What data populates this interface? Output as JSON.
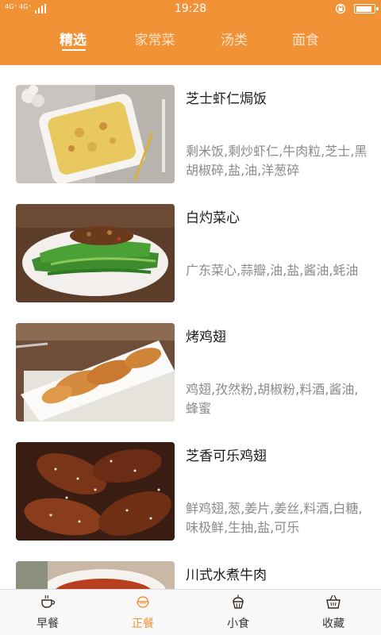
{
  "status_bar": {
    "network": "4G⁺ 4G⁺",
    "time": "19:28"
  },
  "tabs": [
    {
      "label": "精选",
      "active": true
    },
    {
      "label": "家常菜",
      "active": false
    },
    {
      "label": "汤类",
      "active": false
    },
    {
      "label": "面食",
      "active": false
    }
  ],
  "recipes": [
    {
      "title": "芝士虾仁焗饭",
      "ingredients": "剩米饭,剩炒虾仁,牛肉粒,芝士,黑胡椒碎,盐,油,洋葱碎",
      "image": "cheese-baked-rice-photo"
    },
    {
      "title": "白灼菜心",
      "ingredients": "广东菜心,蒜瓣,油,盐,酱油,蚝油",
      "image": "choy-sum-photo"
    },
    {
      "title": "烤鸡翅",
      "ingredients": "鸡翅,孜然粉,胡椒粉,料酒,酱油,蜂蜜",
      "image": "roast-wings-photo"
    },
    {
      "title": "芝香可乐鸡翅",
      "ingredients": "鲜鸡翅,葱,姜片,姜丝,料酒,白糖,味极鲜,生抽,盐,可乐",
      "image": "cola-wings-photo"
    },
    {
      "title": "川式水煮牛肉",
      "ingredients": "",
      "image": "boiled-beef-photo"
    }
  ],
  "bottom_nav": [
    {
      "label": "早餐",
      "icon": "coffee-cup-icon",
      "active": false
    },
    {
      "label": "正餐",
      "icon": "rice-bowl-icon",
      "active": true
    },
    {
      "label": "小食",
      "icon": "cupcake-icon",
      "active": false
    },
    {
      "label": "收藏",
      "icon": "basket-icon",
      "active": false
    }
  ],
  "colors": {
    "accent": "#f29237",
    "title_text": "#1a1a1a",
    "ingredient_text": "#8a8a8a",
    "nav_bg": "#f8f8f8"
  }
}
